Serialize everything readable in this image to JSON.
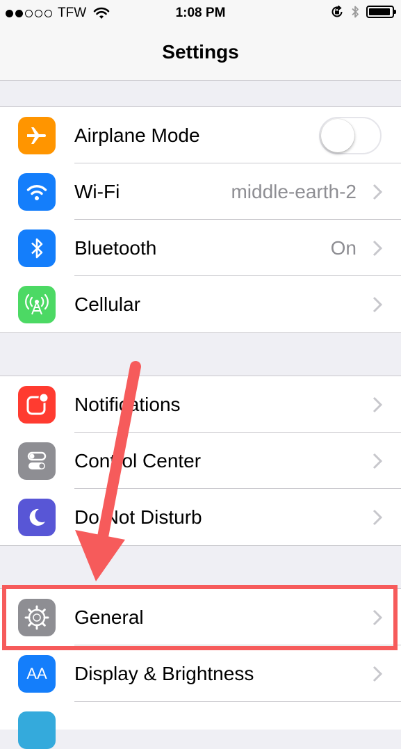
{
  "status_bar": {
    "carrier": "TFW",
    "time": "1:08 PM",
    "signal_dots_filled": 2,
    "signal_dots_total": 5
  },
  "nav": {
    "title": "Settings"
  },
  "groups": [
    [
      {
        "label": "Airplane Mode",
        "icon": "airplane-icon",
        "icon_color": "#ff9500",
        "toggle_on": false
      },
      {
        "label": "Wi-Fi",
        "value": "middle-earth-2",
        "icon": "wifi-icon",
        "icon_color": "#147efb"
      },
      {
        "label": "Bluetooth",
        "value": "On",
        "icon": "bluetooth-icon",
        "icon_color": "#147efb"
      },
      {
        "label": "Cellular",
        "icon": "cellular-icon",
        "icon_color": "#4cd964"
      }
    ],
    [
      {
        "label": "Notifications",
        "icon": "notifications-icon",
        "icon_color": "#ff3b30"
      },
      {
        "label": "Control Center",
        "icon": "control-center-icon",
        "icon_color": "#8e8e93"
      },
      {
        "label": "Do Not Disturb",
        "icon": "moon-icon",
        "icon_color": "#5856d6"
      }
    ],
    [
      {
        "label": "General",
        "icon": "gear-icon",
        "icon_color": "#8e8e93"
      },
      {
        "label": "Display & Brightness",
        "icon": "text-size-icon",
        "icon_color": "#147efb",
        "icon_text": "AA"
      }
    ]
  ],
  "annotation": {
    "color": "#f65b5b"
  }
}
